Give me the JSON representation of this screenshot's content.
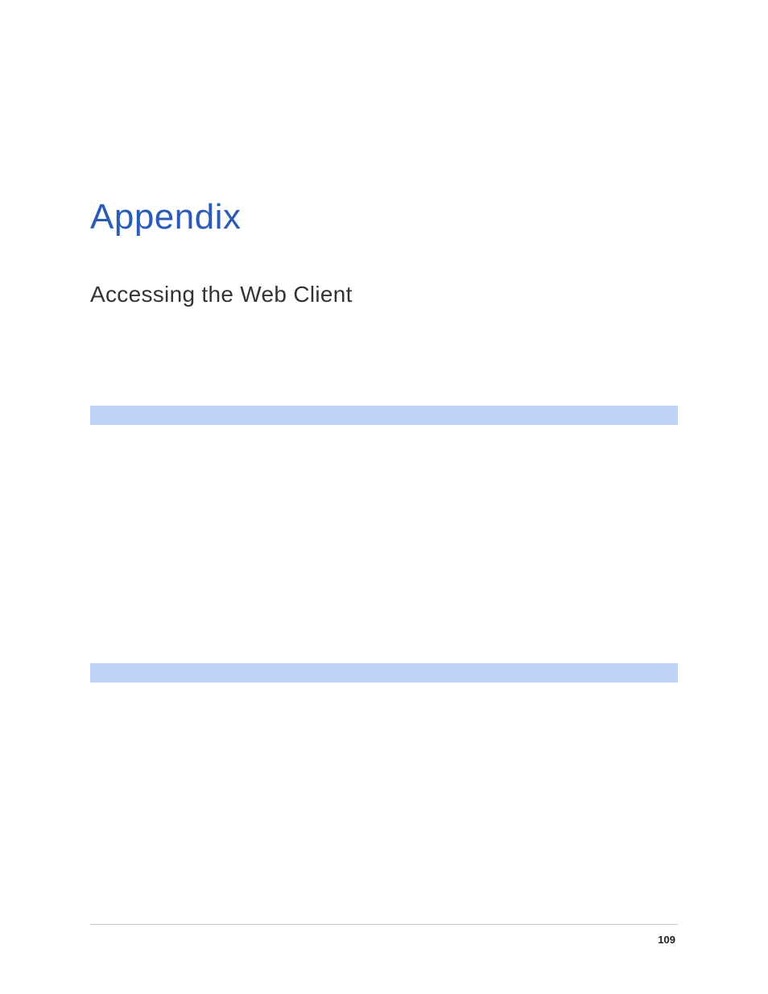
{
  "header": {
    "title": "Appendix",
    "section": "Accessing the Web Client"
  },
  "footer": {
    "page_number": "109"
  }
}
